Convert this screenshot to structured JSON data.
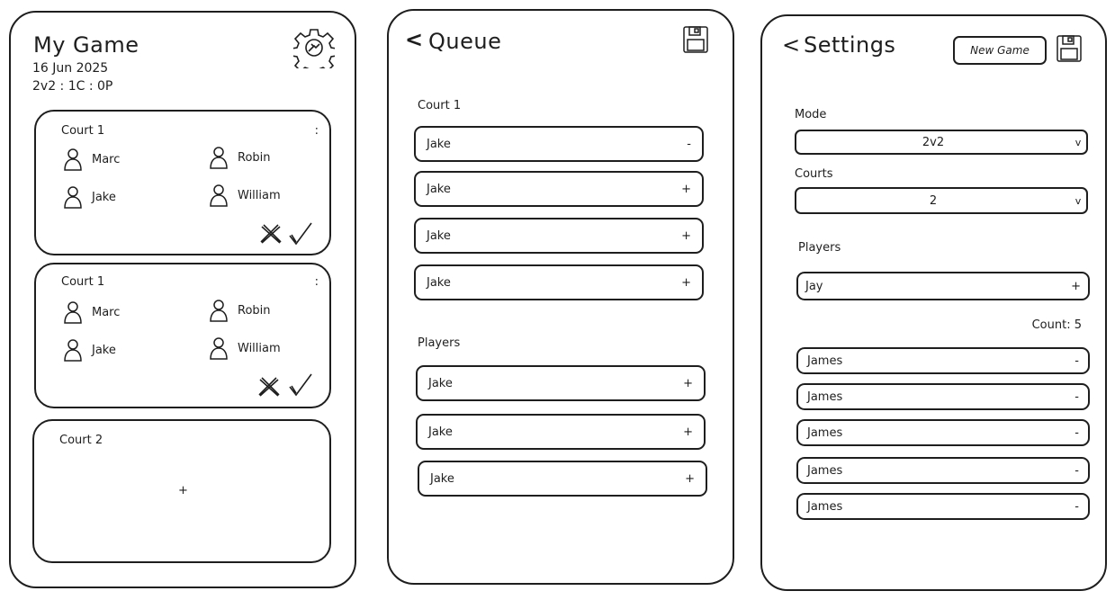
{
  "screen1": {
    "title": "My Game",
    "date": "16 Jun 2025",
    "summary": "2v2 : 1C : 0P",
    "settings_icon": "gear-icon",
    "courts": [
      {
        "label": "Court 1",
        "menu": ":",
        "players": [
          "Marc",
          "Robin",
          "Jake",
          "William"
        ]
      },
      {
        "label": "Court 1",
        "menu": ":",
        "players": [
          "Marc",
          "Robin",
          "Jake",
          "William"
        ]
      }
    ],
    "empty_court": {
      "label": "Court 2",
      "add": "+"
    }
  },
  "screen2": {
    "back": "<",
    "title": "Queue",
    "court_section": "Court 1",
    "court_rows": [
      {
        "name": "Jake",
        "action": "-"
      },
      {
        "name": "Jake",
        "action": "+"
      },
      {
        "name": "Jake",
        "action": "+"
      },
      {
        "name": "Jake",
        "action": "+"
      }
    ],
    "players_section": "Players",
    "player_rows": [
      {
        "name": "Jake",
        "action": "+"
      },
      {
        "name": "Jake",
        "action": "+"
      },
      {
        "name": "Jake",
        "action": "+"
      }
    ]
  },
  "screen3": {
    "back": "<",
    "title": "Settings",
    "new_game": "New Game",
    "mode_label": "Mode",
    "mode_value": "2v2",
    "courts_label": "Courts",
    "courts_value": "2",
    "chevron": "v",
    "players_label": "Players",
    "player_input": "Jay",
    "add": "+",
    "count": "Count: 5",
    "players": [
      "James",
      "James",
      "James",
      "James",
      "James"
    ],
    "remove": "-"
  }
}
